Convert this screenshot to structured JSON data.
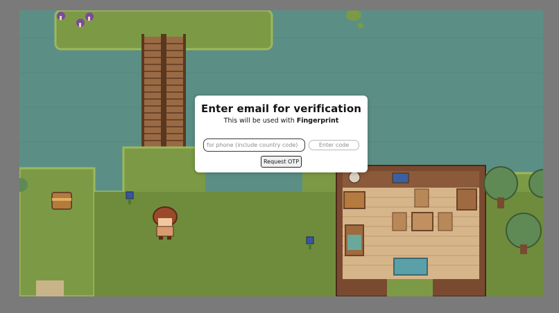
{
  "modal": {
    "title": "Enter email for verification",
    "subtitle_prefix": "This will be used with ",
    "subtitle_brand": "Fingerprint",
    "phone_placeholder": "for phone (include country code)",
    "phone_value": "",
    "code_placeholder": "Enter code",
    "code_value": "",
    "request_button": "Request OTP"
  },
  "colors": {
    "water": "#5b8f85",
    "grass": "#7c9a45",
    "grass_edge": "#9cb85a",
    "wood_floor": "#d7b58a",
    "wood_wall": "#8a5a3a",
    "backdrop": "#7a7a7a"
  }
}
